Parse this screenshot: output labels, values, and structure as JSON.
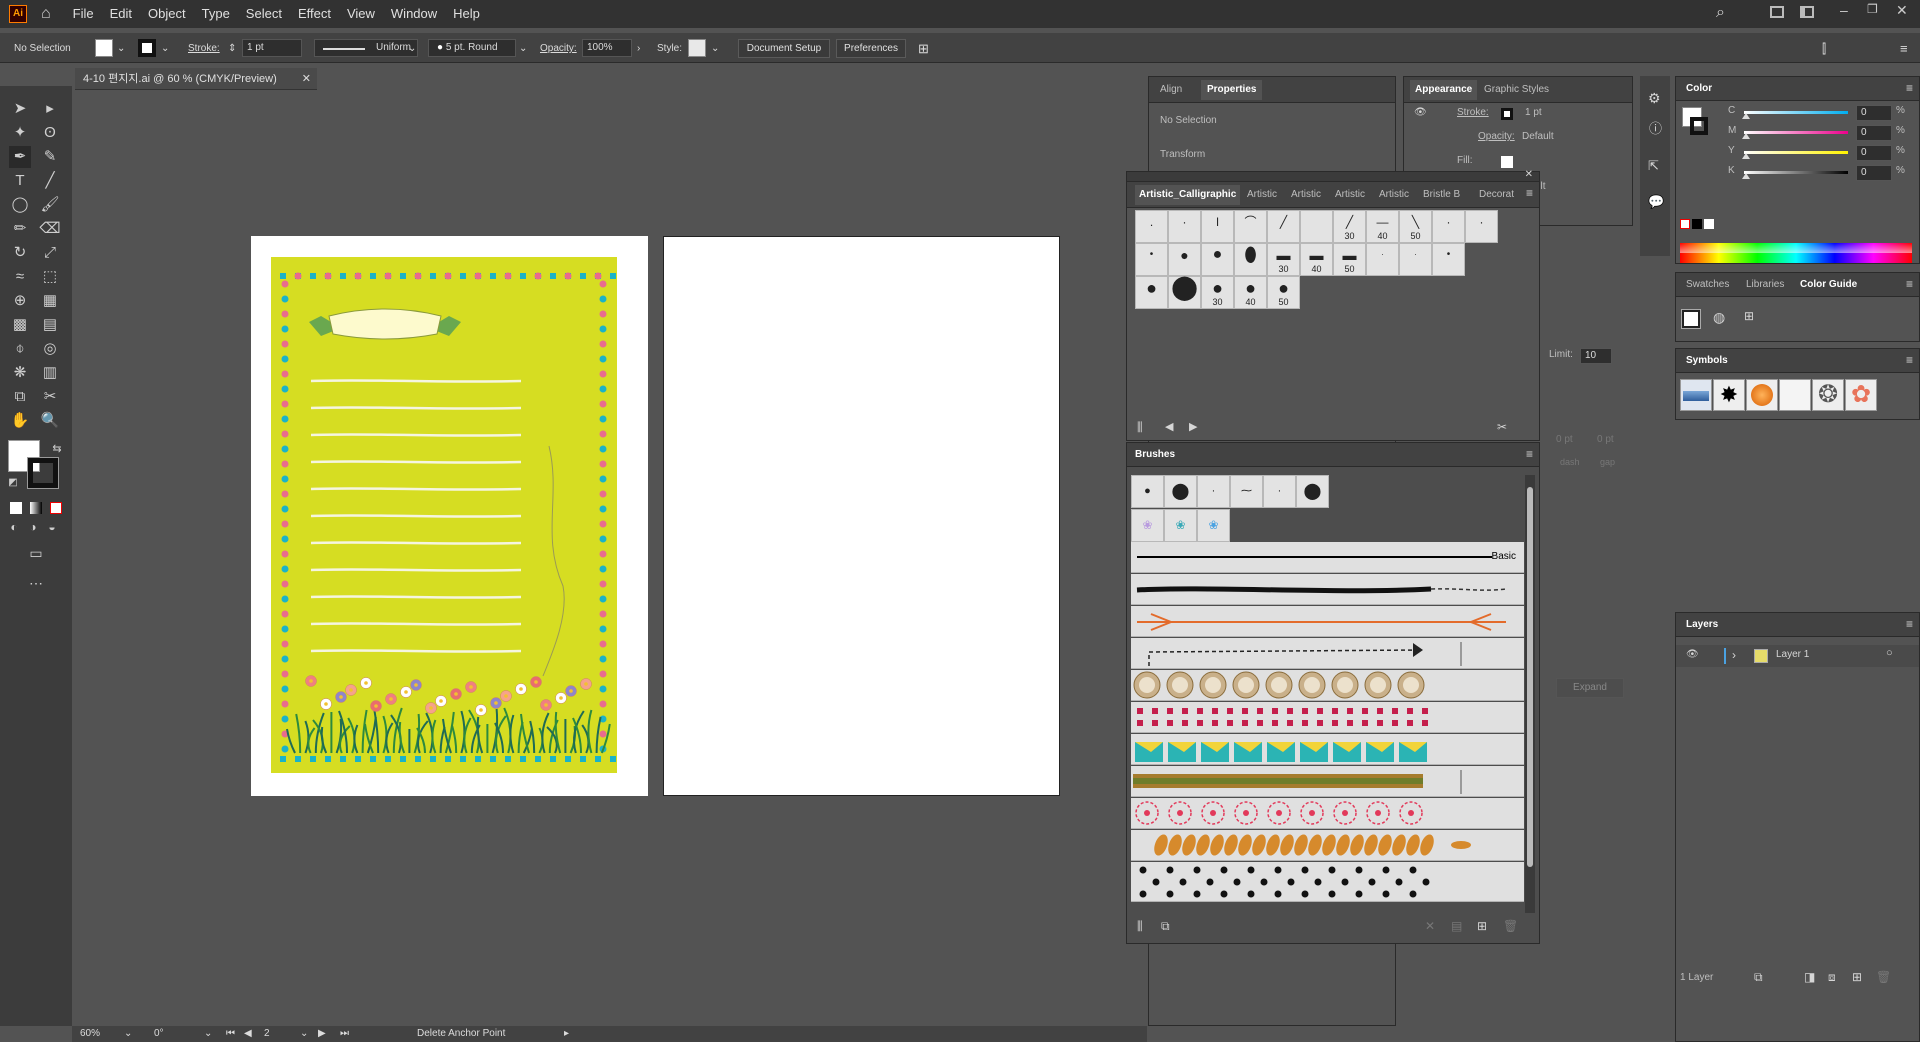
{
  "app": {
    "logo": "Ai",
    "home_icon": "home-icon"
  },
  "menu": [
    "File",
    "Edit",
    "Object",
    "Type",
    "Select",
    "Effect",
    "View",
    "Window",
    "Help"
  ],
  "control": {
    "selection": "No Selection",
    "stroke_label": "Stroke:",
    "stroke_value": "1 pt",
    "profile": "Uniform",
    "brush": "5 pt. Round",
    "opacity_label": "Opacity:",
    "opacity_value": "100%",
    "style_label": "Style:",
    "doc_setup": "Document Setup",
    "preferences": "Preferences"
  },
  "document": {
    "tab_title": "4-10 편지지.ai @ 60 % (CMYK/Preview)"
  },
  "status": {
    "zoom": "60%",
    "rotation": "0°",
    "artboard": "2",
    "tool_hint": "Delete Anchor Point"
  },
  "props_panel": {
    "tabs": [
      "Align",
      "Properties"
    ],
    "no_selection": "No Selection",
    "transform": "Transform",
    "limit_label": "Limit:",
    "limit_value": "10",
    "expand": "Expand",
    "units": [
      "0 pt",
      "0 pt"
    ],
    "dash_labels": [
      "dash",
      "gap"
    ]
  },
  "appearance": {
    "tabs": [
      "Appearance",
      "Graphic Styles"
    ],
    "stroke_label": "Stroke:",
    "stroke_value": "1 pt",
    "opacity_label": "Opacity:",
    "opacity_value": "Default",
    "fill_label": "Fill:",
    "ult": "ult"
  },
  "calligraphic": {
    "tabs": [
      "Artistic_Calligraphic",
      "Artistic",
      "Artistic",
      "Artistic",
      "Artistic",
      "Bristle B",
      "Decorat"
    ],
    "row1": [
      "",
      "",
      "",
      "",
      "",
      "",
      "30",
      "40",
      "50",
      "",
      ""
    ],
    "row2": [
      "",
      "",
      "",
      "",
      "30",
      "40",
      "50",
      "",
      "",
      ""
    ],
    "row3": [
      "",
      "",
      "30",
      "40",
      "50"
    ]
  },
  "brushes": {
    "title": "Brushes",
    "basic_label": "Basic"
  },
  "color": {
    "title": "Color",
    "channels": [
      {
        "k": "C",
        "v": "0",
        "u": "%"
      },
      {
        "k": "M",
        "v": "0",
        "u": "%"
      },
      {
        "k": "Y",
        "v": "0",
        "u": "%"
      },
      {
        "k": "K",
        "v": "0",
        "u": "%"
      }
    ]
  },
  "swatch_tabs": [
    "Swatches",
    "Libraries",
    "Color Guide"
  ],
  "symbols": {
    "title": "Symbols"
  },
  "layers": {
    "title": "Layers",
    "layer_name": "Layer 1",
    "count": "1 Layer"
  },
  "colors": {
    "bg": "#535353",
    "page_green": "#d6dd22",
    "accent": "#4aa2e2"
  }
}
